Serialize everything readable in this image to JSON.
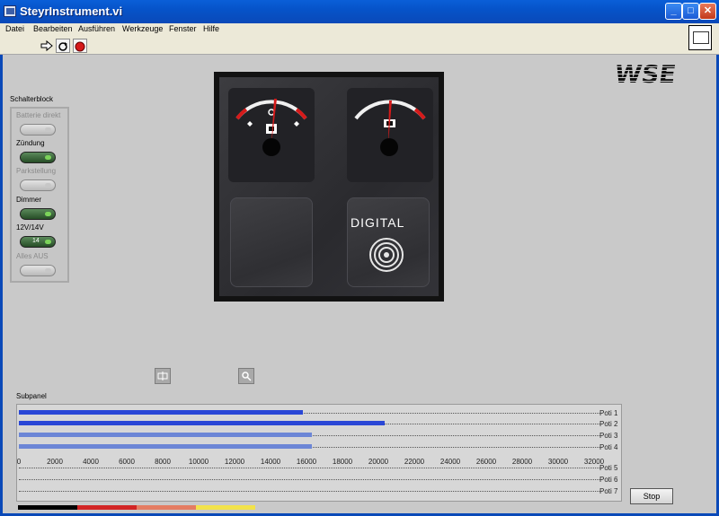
{
  "window": {
    "title": "SteyrInstrument.vi",
    "min": "_",
    "max": "□",
    "close": "✕"
  },
  "menu": [
    "Datei",
    "Bearbeiten",
    "Ausführen",
    "Werkzeuge",
    "Fenster",
    "Hilfe"
  ],
  "toolbar": {
    "icons": [
      "run-arrow-icon",
      "run-continuous-icon",
      "abort-icon"
    ]
  },
  "logo": {
    "text": "WSE"
  },
  "schalterblock": {
    "title": "Schalterblock",
    "switches": [
      {
        "label": "Batterie direkt",
        "state": "off",
        "enabled": false
      },
      {
        "label": "Zündung",
        "state": "on",
        "enabled": true
      },
      {
        "label": "Parkstellung",
        "state": "off",
        "enabled": false
      },
      {
        "label": "Dimmer",
        "state": "on",
        "enabled": true
      },
      {
        "label": "12V/14V",
        "state": "on",
        "enabled": true,
        "text": "14"
      },
      {
        "label": "Alles AUS",
        "state": "off",
        "enabled": false
      }
    ]
  },
  "instrument": {
    "brand": "DIGITAL"
  },
  "subpanel": {
    "title": "Subpanel",
    "potis": [
      {
        "label": "Poti 1",
        "value": 15600,
        "color": "#2a47d6"
      },
      {
        "label": "Poti 2",
        "value": 20100,
        "color": "#2a47d6"
      },
      {
        "label": "Poti 3",
        "value": 16100,
        "color": "#6c86d6"
      },
      {
        "label": "Poti 4",
        "value": 16100,
        "color": "#6c86d6"
      },
      {
        "label": "Poti 5",
        "value": 0,
        "color": "#2a47d6"
      },
      {
        "label": "Poti 6",
        "value": 0,
        "color": "#2a47d6"
      },
      {
        "label": "Poti 7",
        "value": 0,
        "color": "#2a47d6"
      }
    ],
    "scale": {
      "min": 0,
      "max": 32000,
      "ticks": [
        "0",
        "2000",
        "4000",
        "6000",
        "8000",
        "10000",
        "12000",
        "14000",
        "16000",
        "18000",
        "20000",
        "22000",
        "24000",
        "26000",
        "28000",
        "30000",
        "32000"
      ]
    }
  },
  "stop": {
    "label": "Stop"
  },
  "colorbar": [
    "#000000",
    "#d22424",
    "#e47c62",
    "#f2e24a"
  ]
}
